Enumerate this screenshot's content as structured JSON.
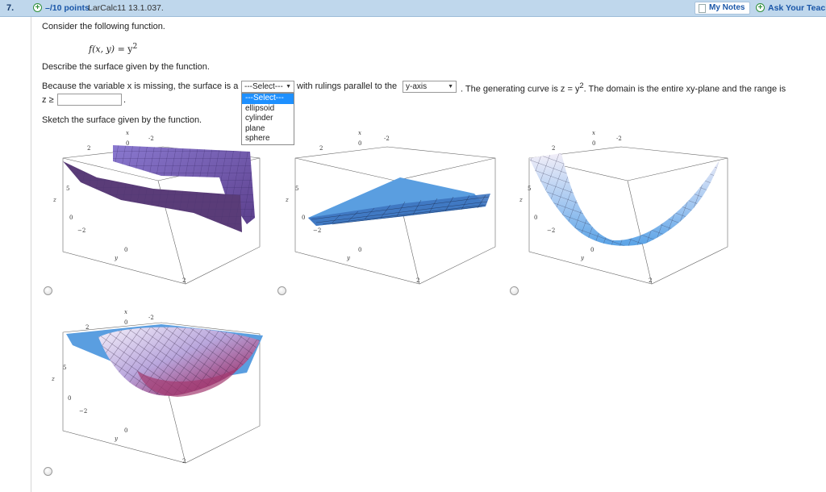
{
  "header": {
    "question_number": "7.",
    "points": "–/10 points",
    "source": "LarCalc11 13.1.037.",
    "my_notes": "My Notes",
    "ask_teacher": "Ask Your Teache"
  },
  "question": {
    "prompt": "Consider the following function.",
    "function_lhs": "f(x, y)",
    "function_rhs_base": "= y",
    "function_rhs_exp": "2",
    "describe": "Describe the surface given by the function.",
    "line1_a": "Because the variable x is missing, the surface is a",
    "line1_b": "with rulings parallel to the",
    "line1_c_pre": ". The generating curve is z = y",
    "line1_c_exp": "2",
    "line1_c_post": ". The domain is the entire xy-plane and the range is",
    "z_prefix": "z ≥",
    "z_suffix": ".",
    "sketch": "Sketch the surface given by the function."
  },
  "surface_select": {
    "value": "---Select---",
    "options": [
      "---Select---",
      "ellipsoid",
      "cylinder",
      "plane",
      "sphere"
    ],
    "highlighted_index": 0
  },
  "axis_select": {
    "value": "y-axis"
  },
  "range_input": {
    "value": ""
  },
  "graph_labels": {
    "x": "x",
    "y": "y",
    "z": "z",
    "t0": "0",
    "tneg2": "-2",
    "t2": "2",
    "t5": "5",
    "tneg2b": "−2"
  },
  "options": [
    {
      "name": "option-a",
      "selected": false
    },
    {
      "name": "option-b",
      "selected": false
    },
    {
      "name": "option-c",
      "selected": false
    },
    {
      "name": "option-d",
      "selected": false
    }
  ],
  "colors": {
    "header_bg": "#bfd7ec",
    "link_blue": "#1a56a8",
    "highlight": "#1e90ff",
    "surface_purple": "#7b5fb5",
    "surface_blue": "#5aa3e6"
  }
}
